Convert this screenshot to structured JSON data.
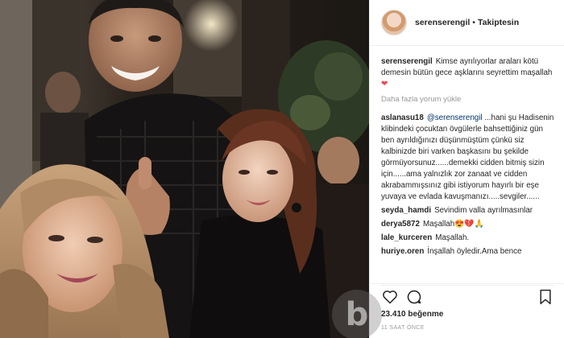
{
  "post": {
    "author": "serenserengil",
    "follow_status": "Takiptesin",
    "separator": "•",
    "caption": "Kimse ayrılıyorlar araları kötü demesin bütün gece aşklarını seyrettim maşallah",
    "caption_emoji": "❤",
    "load_more": "Daha fazla yorum yükle",
    "likes": "23.410 beğenme",
    "time_ago": "11 SAAT ÖNCE"
  },
  "comments": [
    {
      "user": "aslanasu18",
      "mention": "@serenserengil",
      "text": " ...hani şu Hadisenin klibindeki çocuktan övgülerle bahsettiğiniz gün ben ayrıldığınızı düşünmüştüm çünkü siz kalbinizde biri varken başkasını bu şekilde görmüyorsunuz......demekki cidden bitmiş sizin için......ama yalnızlık zor zanaat ve cidden akrabammışsınız gibi istiyorum hayırlı bir eşe yuvaya ve evlada kavuşmanızı.....sevgiler......"
    },
    {
      "user": "seyda_hamdi",
      "mention": "",
      "text": "Sevindim valla ayrılmasınlar"
    },
    {
      "user": "derya5872",
      "mention": "",
      "text": "Maşallah😍💔🙏"
    },
    {
      "user": "lale_kurceren",
      "mention": "",
      "text": "Maşallah."
    },
    {
      "user": "huriye.oren",
      "mention": "",
      "text": "İnşallah öyledir.Ama bence"
    }
  ],
  "icons": {
    "like": "heart-icon",
    "comment": "comment-icon",
    "save": "bookmark-icon",
    "watermark": "b"
  },
  "colors": {
    "text": "#262626",
    "muted": "#999999",
    "mention": "#003569",
    "heart": "#ed4956",
    "border": "#efefef"
  }
}
